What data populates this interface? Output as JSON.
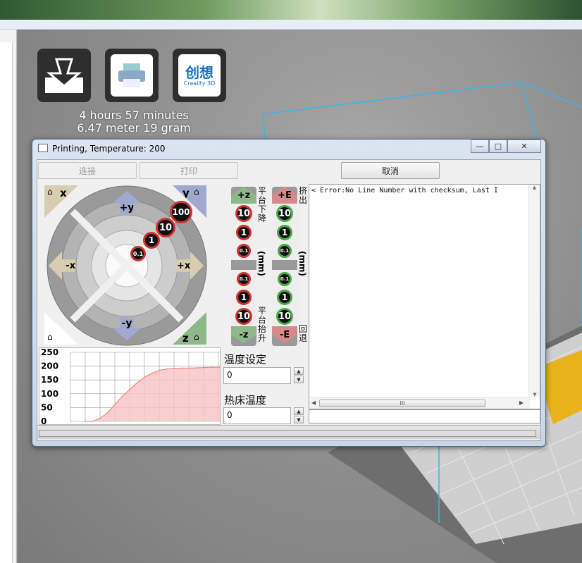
{
  "toolbar": {
    "icons": [
      "load-model-icon",
      "print-icon",
      "creality-logo-icon"
    ],
    "logo_text": "Creality 3D"
  },
  "print_info": {
    "time": "4 hours 57 minutes",
    "material": "6.47 meter 19 gram"
  },
  "dialog": {
    "title": "Printing, Temperature: 200",
    "window_buttons": {
      "minimize": "—",
      "maximize": "□",
      "close": "✕"
    },
    "connect_label": "连接",
    "print_label": "打印",
    "cancel_label": "取消"
  },
  "xy_jog": {
    "home_x": "x",
    "home_y": "y",
    "home_z": "z",
    "plus_y": "+y",
    "minus_y": "-y",
    "minus_x": "-x",
    "plus_x": "+x",
    "steps": [
      "100",
      "10",
      "1",
      "0.1"
    ]
  },
  "z_column": {
    "plus": "+z",
    "minus": "-z",
    "steps_up": [
      "10",
      "1",
      "0.1"
    ],
    "steps_down": [
      "0.1",
      "1",
      "10"
    ],
    "top_label": [
      "平",
      "台",
      "下",
      "降"
    ],
    "unit": "(mm)",
    "bottom_label": [
      "平",
      "台",
      "抬",
      "升"
    ]
  },
  "e_column": {
    "plus": "+E",
    "minus": "-E",
    "steps_up": [
      "10",
      "1",
      "0.1"
    ],
    "steps_down": [
      "0.1",
      "1",
      "10"
    ],
    "top_label": [
      "挤",
      "出"
    ],
    "unit": "(mm)",
    "bottom_label": [
      "回",
      "退"
    ]
  },
  "temperature": {
    "nozzle_label": "温度设定",
    "nozzle_value": "0",
    "bed_label": "热床温度",
    "bed_value": "0"
  },
  "log": {
    "text": "< Error:No Line Number with checksum, Last I",
    "scroll_thumb": "III"
  },
  "chart_data": {
    "type": "area",
    "title": "",
    "y_ticks": [
      "250",
      "200",
      "150",
      "100",
      "50",
      "0"
    ],
    "ylim": [
      0,
      250
    ],
    "x": [
      0,
      5,
      10,
      15,
      20,
      25,
      30,
      35,
      40,
      45,
      50,
      55,
      60,
      65,
      70,
      75,
      80,
      85,
      90
    ],
    "values": [
      0,
      0,
      10,
      30,
      60,
      90,
      115,
      140,
      160,
      175,
      185,
      190,
      192,
      193,
      193,
      194,
      195,
      196,
      196
    ],
    "colors": {
      "fill": "#f6c2c2",
      "line": "#e77",
      "grid": "#999"
    }
  },
  "status": {
    "progress": 0
  }
}
